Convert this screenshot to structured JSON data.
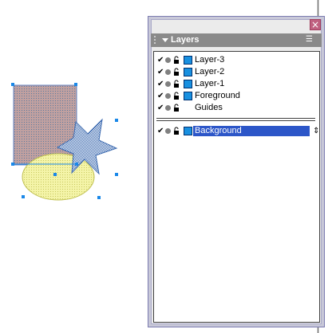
{
  "panel": {
    "title": "Layers",
    "close_glyph": "×",
    "menu_glyph": "☰",
    "layers": [
      {
        "name": "Layer-3",
        "checked": "✔",
        "color": "#1890e0"
      },
      {
        "name": "Layer-2",
        "checked": "✔",
        "color": "#1890e0"
      },
      {
        "name": "Layer-1",
        "checked": "✔",
        "color": "#1890e0"
      },
      {
        "name": "Foreground",
        "checked": "✔",
        "color": "#1890e0"
      },
      {
        "name": "Guides",
        "checked": "✔",
        "color": "none"
      }
    ],
    "background_layer": {
      "name": "Background",
      "checked": "✔",
      "selected": true,
      "pin_glyph": "⇕"
    }
  },
  "colors": {
    "rect_fill": "#b09090",
    "ellipse_fill": "#f0f0a0",
    "star_fill": "#7090b0",
    "handle": "#1a88e8",
    "selection_bg": "#2c56c8"
  },
  "icons": [
    "check-icon",
    "eye-icon",
    "lock-icon",
    "layer-color-icon",
    "pin-icon",
    "close-icon",
    "panel-menu-icon",
    "collapse-arrow-icon"
  ]
}
